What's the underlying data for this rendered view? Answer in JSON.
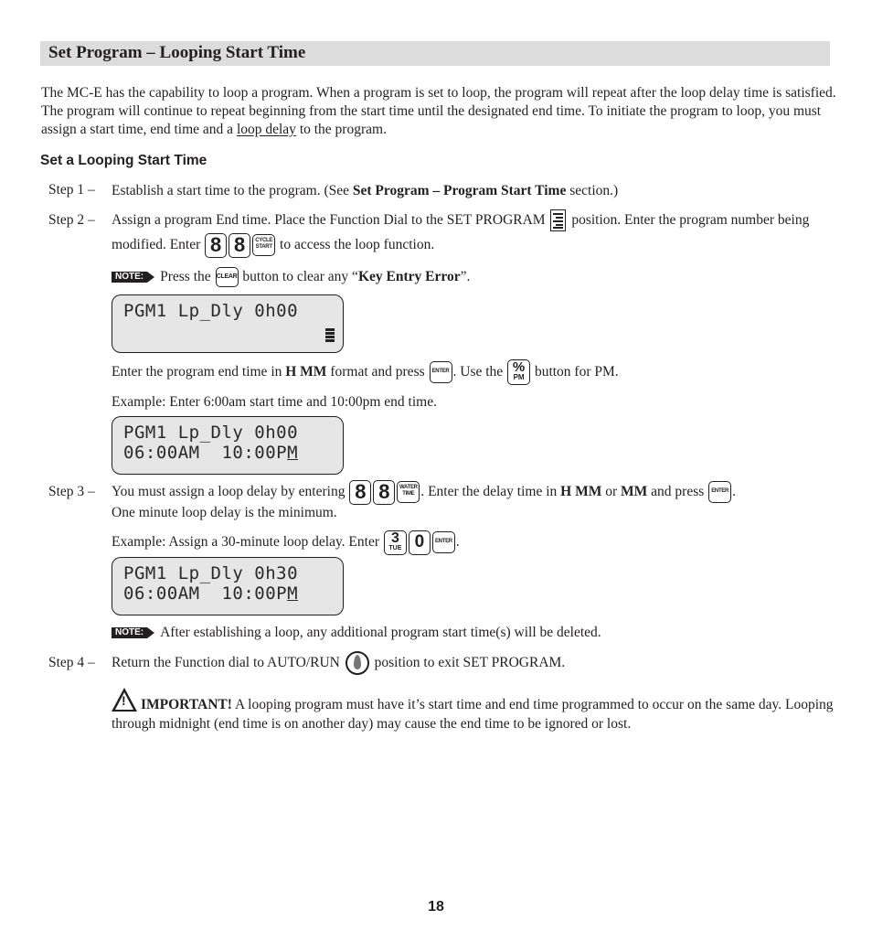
{
  "header": {
    "title": "Set Program – Looping Start Time"
  },
  "intro": {
    "text_before_link": "The MC-E has the capability to loop a program. When a program is set to loop, the program will repeat after the loop delay time is satisfied. The program will continue to repeat beginning from the start time until the designated end time. To initiate the program to loop, you must assign a start time, end time and a ",
    "link": "loop delay",
    "text_after_link": " to the program."
  },
  "subheading": "Set a Looping Start Time",
  "steps": [
    {
      "label": "Step 1 –",
      "text_a": "Establish a start time to the program. (See ",
      "bold": "Set Program – Program Start Time",
      "text_b": " section.)"
    },
    {
      "label": "Step 2 –",
      "text_a": "Assign a program End time. Place the Function Dial to the SET PROGRAM ",
      "text_b": " position. Enter the program number being modified. Enter ",
      "text_c": " to access the loop function.",
      "note_text_a": "Press the ",
      "note_text_b": " button to clear any “",
      "note_bold": "Key Entry Error",
      "note_text_c": "”.",
      "end_time_a": "Enter the program end time in ",
      "end_time_bold": "H MM",
      "end_time_b": " format and press ",
      "end_time_c": ". Use the ",
      "end_time_d": " button for PM.",
      "example": "Example: Enter 6:00am start time and 10:00pm end time."
    },
    {
      "label": "Step 3 –",
      "text_a": "You must assign a loop delay by entering ",
      "text_b": ". Enter the delay time in ",
      "bold_a": "H MM",
      "text_c": " or ",
      "bold_b": "MM",
      "text_d": " and press ",
      "text_e": ".",
      "line2": "One minute loop delay is the minimum.",
      "example": "Example: Assign a 30-minute loop delay. Enter ",
      "example_end": ".",
      "note_text": "After establishing a loop, any additional program start time(s) will be deleted."
    },
    {
      "label": "Step 4 –",
      "text_a": "Return the Function dial to AUTO/RUN ",
      "text_b": " position to exit SET PROGRAM."
    }
  ],
  "important": {
    "label": "IMPORTANT!",
    "text": " A looping program must have it’s start time and end time programmed to occur on the same day. Looping through midnight (end time is on another day) may cause the end time to be ignored or lost."
  },
  "note_badge": "NOTE:",
  "keys": {
    "eight": "8",
    "cycle_start": "CYCLE START",
    "clear": "CLEAR",
    "enter": "ENTER",
    "pct_top": "%",
    "pct_bottom": "PM",
    "water_time": "WATER TIME",
    "three_top": "3",
    "three_bottom": "TUE",
    "zero": "0"
  },
  "lcd_displays": [
    {
      "line1": "PGM1 Lp_Dly 0h00",
      "line2": ""
    },
    {
      "line1": "PGM1 Lp_Dly 0h00",
      "line2_main": "06:00AM  10:00P",
      "line2_cursor": "M"
    },
    {
      "line1": "PGM1 Lp_Dly 0h30",
      "line2_main": "06:00AM  10:00P",
      "line2_cursor": "M"
    }
  ],
  "page_number": "18"
}
